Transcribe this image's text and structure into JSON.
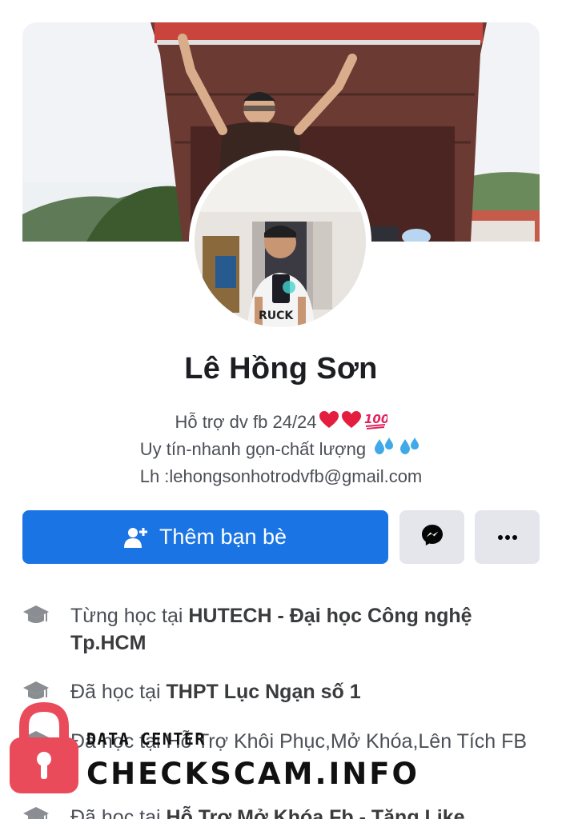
{
  "profile": {
    "name": "Lê Hồng Sơn",
    "bio_line1": "Hỗ trợ dv fb 24/24",
    "bio_line2": "Uy tín-nhanh gọn-chất lượng",
    "bio_line3": "Lh :lehongsonhotrodvfb@gmail.com"
  },
  "actions": {
    "add_friend_label": "Thêm bạn bè",
    "accent": "#1b74e4"
  },
  "icons": {
    "add_friend": "person-plus-icon",
    "messenger": "messenger-icon",
    "more": "more-dots-icon",
    "education": "graduation-cap-icon",
    "bio_emoji_1": "red-heart-icon",
    "bio_emoji_2": "hundred-points-icon",
    "bio_emoji_3": "sweat-droplets-icon"
  },
  "info": [
    {
      "prefix": "Từng học tại ",
      "bold": "HUTECH - Đại học Công nghệ Tp.HCM"
    },
    {
      "prefix": "Đã học tại ",
      "bold": "THPT Lục Ngạn số 1"
    },
    {
      "prefix": "Đã học tại ",
      "bold": "Hỗ Trợ Khôi Phục,Mở Khóa,Lên Tích FB"
    },
    {
      "prefix": "Đã học tại ",
      "bold": "Hỗ Trợ Mở Khóa Fb - Tăng Like"
    }
  ],
  "watermark": {
    "line1": "DATA CENTER",
    "line2": "CHECKSCAM.INFO",
    "lock_color": "#ea4b5b"
  }
}
